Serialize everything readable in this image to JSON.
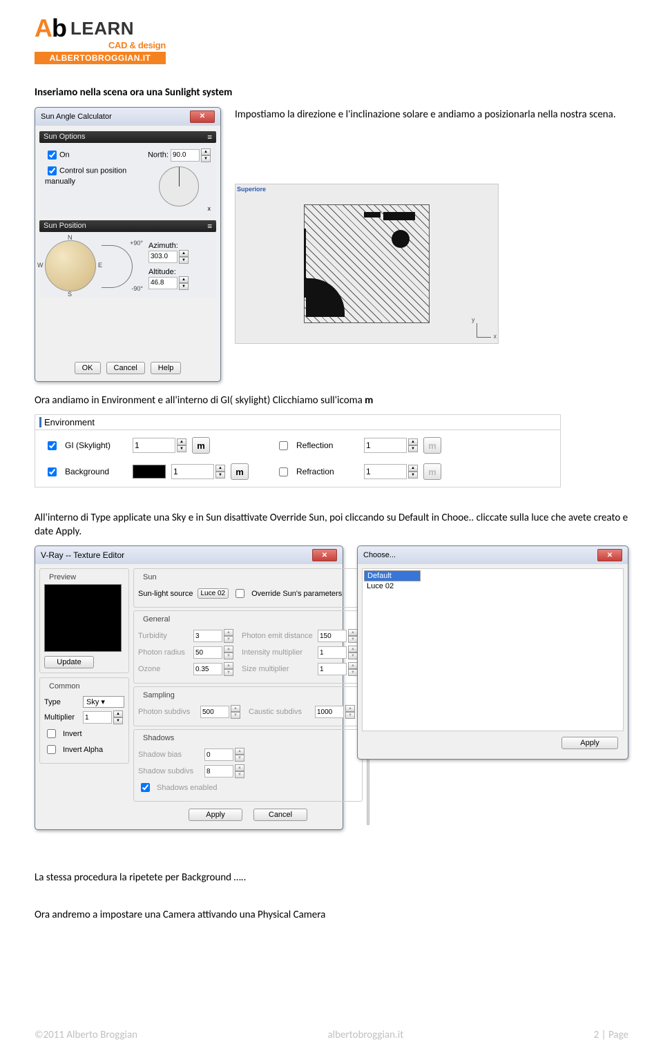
{
  "logo": {
    "learn": "LEARN",
    "sub": "CAD & design",
    "bar": "ALBERTOBROGGIAN.IT"
  },
  "text": {
    "intro1_bold": "Inseriamo nella scena ora una Sunlight system",
    "intro2": "Impostiamo la direzione e l'inclinazione solare e andiamo a posizionarla nella nostra scena.",
    "env_line_pre": "Ora andiamo in Environment e all'interno di GI( skylight) Clicchiamo sull'icoma ",
    "env_line_m": "m",
    "type_line": "All'interno di Type applicate una Sky e in Sun disattivate Override Sun,  poi cliccando su Default in Chooe.. cliccate sulla luce che avete creato e date Apply.",
    "bg_line": "La stessa procedura la ripetete per Background …..",
    "camera_line": "Ora andremo a impostare una Camera attivando una Physical Camera"
  },
  "sun_dialog": {
    "title": "Sun Angle Calculator",
    "sections": {
      "options": "Sun Options",
      "position": "Sun Position"
    },
    "on": "On",
    "manual": "Control sun position manually",
    "north_label": "North:",
    "north_value": "90.0",
    "north_x": "x",
    "dir_labels": {
      "N": "N",
      "E": "E",
      "S": "S",
      "W": "W"
    },
    "alt_labels": {
      "p90": "+90°",
      "n90": "-90°"
    },
    "azimuth_label": "Azimuth:",
    "azimuth_value": "303.0",
    "altitude_label": "Altitude:",
    "altitude_value": "46.8",
    "buttons": {
      "ok": "OK",
      "cancel": "Cancel",
      "help": "Help"
    }
  },
  "viewport": {
    "label": "Superiore",
    "axis_y": "y",
    "axis_x": "x"
  },
  "env": {
    "title": "Environment",
    "gi_label": "GI (Skylight)",
    "gi_value": "1",
    "bg_label": "Background",
    "bg_value": "1",
    "refl_label": "Reflection",
    "refl_value": "1",
    "refr_label": "Refraction",
    "refr_value": "1",
    "m": "m"
  },
  "tex": {
    "title": "V-Ray -- Texture Editor",
    "preview": "Preview",
    "update": "Update",
    "common": "Common",
    "type_label": "Type",
    "type_value": "Sky",
    "mult_label": "Multiplier",
    "mult_value": "1",
    "invert": "Invert",
    "invert_alpha": "Invert Alpha",
    "sun_group": "Sun",
    "sun_src_label": "Sun-light source",
    "sun_src_value": "Luce 02",
    "override": "Override Sun's parameters",
    "general": "General",
    "turbidity_label": "Turbidity",
    "turbidity_value": "3",
    "photon_emit_label": "Photon emit distance",
    "photon_emit_value": "150",
    "photon_radius_label": "Photon radius",
    "photon_radius_value": "50",
    "intensity_label": "Intensity multiplier",
    "intensity_value": "1",
    "ozone_label": "Ozone",
    "ozone_value": "0.35",
    "size_label": "Size multiplier",
    "size_value": "1",
    "sampling": "Sampling",
    "photon_subdivs_label": "Photon subdivs",
    "photon_subdivs_value": "500",
    "caustic_subdivs_label": "Caustic subdivs",
    "caustic_subdivs_value": "1000",
    "shadows": "Shadows",
    "shadow_bias_label": "Shadow bias",
    "shadow_bias_value": "0",
    "shadow_subdivs_label": "Shadow subdivs",
    "shadow_subdivs_value": "8",
    "shadows_enabled": "Shadows enabled",
    "apply": "Apply",
    "cancel": "Cancel"
  },
  "choose": {
    "title": "Choose...",
    "items": [
      "Default",
      "Luce 02"
    ],
    "apply": "Apply"
  },
  "footer": {
    "left": "©2011 Alberto Broggian",
    "center": "albertobroggian.it",
    "right": "2 | Page"
  }
}
